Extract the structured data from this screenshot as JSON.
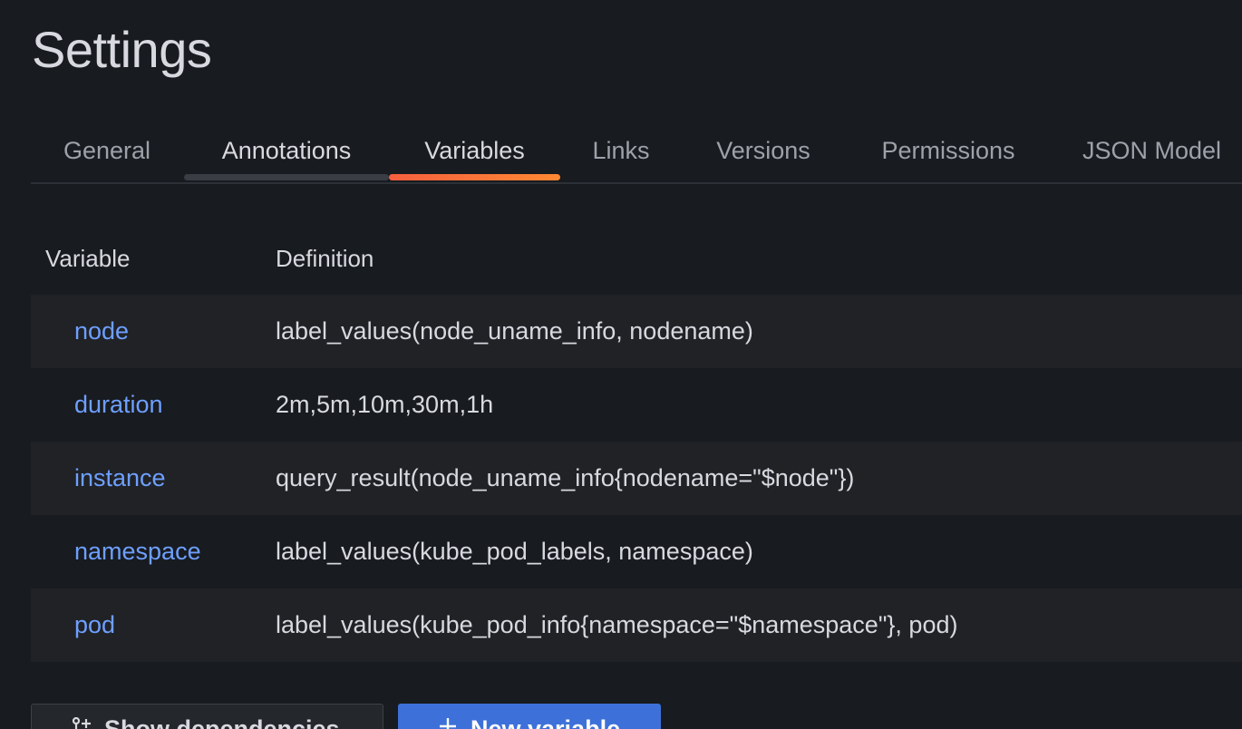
{
  "page": {
    "title": "Settings"
  },
  "tabs": [
    {
      "label": "General"
    },
    {
      "label": "Annotations"
    },
    {
      "label": "Variables"
    },
    {
      "label": "Links"
    },
    {
      "label": "Versions"
    },
    {
      "label": "Permissions"
    },
    {
      "label": "JSON Model"
    }
  ],
  "active_tab": "Variables",
  "table": {
    "headers": {
      "variable": "Variable",
      "definition": "Definition"
    },
    "rows": [
      {
        "name": "node",
        "definition": "label_values(node_uname_info, nodename)"
      },
      {
        "name": "duration",
        "definition": "2m,5m,10m,30m,1h"
      },
      {
        "name": "instance",
        "definition": "query_result(node_uname_info{nodename=\"$node\"})"
      },
      {
        "name": "namespace",
        "definition": "label_values(kube_pod_labels, namespace)"
      },
      {
        "name": "pod",
        "definition": "label_values(kube_pod_info{namespace=\"$namespace\"}, pod)"
      }
    ]
  },
  "actions": {
    "show_dependencies": "Show dependencies",
    "new_variable": "New variable"
  },
  "icons": {
    "dependencies": "git-branch-icon",
    "add": "plus-icon"
  },
  "colors": {
    "background": "#181b1f",
    "link": "#6e9fff",
    "accent": "#ff8833",
    "primary_button": "#3d71d9"
  }
}
